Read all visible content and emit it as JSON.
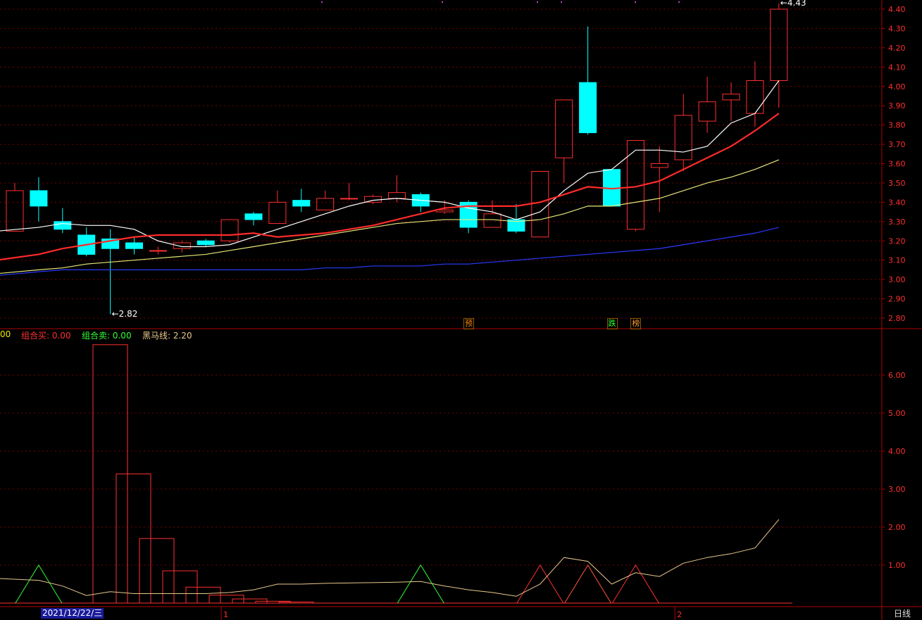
{
  "chart_data": [
    {
      "type": "candlestick",
      "price_axis": {
        "min": 2.8,
        "max": 4.4,
        "ticks": [
          "4.40",
          "4.30",
          "4.20",
          "4.10",
          "4.00",
          "3.90",
          "3.80",
          "3.70",
          "3.60",
          "3.50",
          "3.40",
          "3.30",
          "3.20",
          "3.10",
          "3.00",
          "2.90",
          "2.80"
        ]
      },
      "candles": [
        {
          "o": 3.25,
          "h": 3.5,
          "l": 3.25,
          "c": 3.46
        },
        {
          "o": 3.46,
          "h": 3.53,
          "l": 3.3,
          "c": 3.38
        },
        {
          "o": 3.3,
          "h": 3.37,
          "l": 3.24,
          "c": 3.26
        },
        {
          "o": 3.23,
          "h": 3.27,
          "l": 3.12,
          "c": 3.13
        },
        {
          "o": 3.21,
          "h": 3.26,
          "l": 2.82,
          "c": 3.16
        },
        {
          "o": 3.19,
          "h": 3.22,
          "l": 3.13,
          "c": 3.16
        },
        {
          "o": 3.15,
          "h": 3.17,
          "l": 3.13,
          "c": 3.15
        },
        {
          "o": 3.16,
          "h": 3.2,
          "l": 3.14,
          "c": 3.19
        },
        {
          "o": 3.2,
          "h": 3.21,
          "l": 3.17,
          "c": 3.18
        },
        {
          "o": 3.2,
          "h": 3.31,
          "l": 3.19,
          "c": 3.31
        },
        {
          "o": 3.34,
          "h": 3.35,
          "l": 3.28,
          "c": 3.31
        },
        {
          "o": 3.29,
          "h": 3.46,
          "l": 3.29,
          "c": 3.4
        },
        {
          "o": 3.41,
          "h": 3.47,
          "l": 3.35,
          "c": 3.38
        },
        {
          "o": 3.36,
          "h": 3.46,
          "l": 3.36,
          "c": 3.42
        },
        {
          "o": 3.42,
          "h": 3.5,
          "l": 3.41,
          "c": 3.42
        },
        {
          "o": 3.4,
          "h": 3.44,
          "l": 3.39,
          "c": 3.43
        },
        {
          "o": 3.42,
          "h": 3.54,
          "l": 3.4,
          "c": 3.45
        },
        {
          "o": 3.44,
          "h": 3.45,
          "l": 3.35,
          "c": 3.38
        },
        {
          "o": 3.35,
          "h": 3.41,
          "l": 3.34,
          "c": 3.36
        },
        {
          "o": 3.4,
          "h": 3.41,
          "l": 3.24,
          "c": 3.27
        },
        {
          "o": 3.27,
          "h": 3.41,
          "l": 3.27,
          "c": 3.34
        },
        {
          "o": 3.31,
          "h": 3.39,
          "l": 3.24,
          "c": 3.25
        },
        {
          "o": 3.22,
          "h": 3.56,
          "l": 3.22,
          "c": 3.56
        },
        {
          "o": 3.63,
          "h": 3.93,
          "l": 3.5,
          "c": 3.93
        },
        {
          "o": 4.02,
          "h": 4.31,
          "l": 3.75,
          "c": 3.76
        },
        {
          "o": 3.57,
          "h": 3.57,
          "l": 3.38,
          "c": 3.38
        },
        {
          "o": 3.26,
          "h": 3.72,
          "l": 3.25,
          "c": 3.72
        },
        {
          "o": 3.58,
          "h": 3.69,
          "l": 3.35,
          "c": 3.6
        },
        {
          "o": 3.62,
          "h": 3.96,
          "l": 3.56,
          "c": 3.85
        },
        {
          "o": 3.82,
          "h": 4.05,
          "l": 3.76,
          "c": 3.92
        },
        {
          "o": 3.93,
          "h": 4.02,
          "l": 3.82,
          "c": 3.96
        },
        {
          "o": 3.86,
          "h": 4.13,
          "l": 3.79,
          "c": 4.03
        },
        {
          "o": 4.03,
          "h": 4.43,
          "l": 3.89,
          "c": 4.4
        }
      ],
      "ma_lines": [
        {
          "color": "#ffffff",
          "values": [
            3.25,
            3.27,
            3.29,
            3.28,
            3.28,
            3.26,
            3.2,
            3.17,
            3.17,
            3.18,
            3.22,
            3.26,
            3.3,
            3.34,
            3.38,
            3.41,
            3.42,
            3.41,
            3.4,
            3.37,
            3.35,
            3.31,
            3.35,
            3.46,
            3.55,
            3.57,
            3.67,
            3.67,
            3.66,
            3.69,
            3.81,
            3.86,
            4.03
          ]
        },
        {
          "color": "#ff2a2a",
          "values": [
            3.1,
            3.13,
            3.16,
            3.18,
            3.2,
            3.22,
            3.23,
            3.23,
            3.23,
            3.23,
            3.24,
            3.22,
            3.23,
            3.24,
            3.26,
            3.28,
            3.31,
            3.34,
            3.37,
            3.38,
            3.38,
            3.38,
            3.4,
            3.44,
            3.48,
            3.47,
            3.48,
            3.51,
            3.57,
            3.63,
            3.69,
            3.77,
            3.86
          ]
        },
        {
          "color": "#e8e87a",
          "values": [
            3.03,
            3.05,
            3.06,
            3.08,
            3.09,
            3.1,
            3.11,
            3.12,
            3.13,
            3.15,
            3.17,
            3.19,
            3.21,
            3.23,
            3.25,
            3.27,
            3.29,
            3.3,
            3.31,
            3.31,
            3.31,
            3.3,
            3.31,
            3.34,
            3.38,
            3.38,
            3.4,
            3.42,
            3.46,
            3.5,
            3.53,
            3.57,
            3.62
          ]
        },
        {
          "color": "#2a3aff",
          "values": [
            3.02,
            3.04,
            3.05,
            3.05,
            3.05,
            3.05,
            3.05,
            3.05,
            3.05,
            3.05,
            3.05,
            3.05,
            3.05,
            3.06,
            3.06,
            3.07,
            3.07,
            3.07,
            3.08,
            3.08,
            3.09,
            3.1,
            3.11,
            3.12,
            3.13,
            3.14,
            3.15,
            3.16,
            3.18,
            3.2,
            3.22,
            3.24,
            3.27
          ]
        }
      ],
      "annotations": [
        {
          "text": "4.43",
          "index": 32,
          "price": 4.43
        },
        {
          "text": "2.82",
          "index": 4,
          "price": 2.82
        }
      ],
      "event_tags": [
        {
          "text": "预",
          "index": 19,
          "color": "#ff8800"
        },
        {
          "text": "跌",
          "index": 25,
          "color": "#33ff33"
        },
        {
          "text": "榜",
          "index": 26,
          "color": "#ff9933"
        }
      ]
    },
    {
      "type": "indicator",
      "y_axis": {
        "min": 0,
        "max": 7.0,
        "ticks": [
          "6.00",
          "5.00",
          "4.00",
          "3.00",
          "2.00",
          "1.00"
        ]
      },
      "legend": [
        {
          "text": "00",
          "color": "#e8e800"
        },
        {
          "text": "组合买: 0.00",
          "color": "#ff3030"
        },
        {
          "text": "组合卖: 0.00",
          "color": "#33ff33"
        },
        {
          "text": "黑马线: 2.20",
          "color": "#e8c88c"
        }
      ],
      "cascade_boxes": [
        6.8,
        3.4,
        1.7,
        0.85,
        0.42,
        0.21,
        0.11,
        0.05,
        0.03
      ],
      "black_horse_line": [
        0.65,
        0.6,
        0.45,
        0.2,
        0.3,
        0.25,
        0.25,
        0.25,
        0.25,
        0.28,
        0.35,
        0.5,
        0.5,
        0.52,
        0.53,
        0.54,
        0.55,
        0.57,
        0.45,
        0.35,
        0.28,
        0.18,
        0.5,
        1.2,
        1.1,
        0.5,
        0.8,
        0.7,
        1.05,
        1.2,
        1.3,
        1.45,
        2.2
      ],
      "buy_triangles": [
        22,
        24,
        26
      ],
      "sell_triangles": [
        1,
        17,
        24
      ]
    }
  ],
  "x_axis": {
    "date_label": "2021/12/22/三",
    "month_markers": [
      {
        "text": "1",
        "index": 9
      },
      {
        "text": "2",
        "index": 28
      }
    ]
  },
  "period_button": "日线",
  "colors": {
    "grid": "#7a0000",
    "axis": "#b00000",
    "up": "#ff3030",
    "down": "#00ffff",
    "axis_text": "#ff3030"
  }
}
